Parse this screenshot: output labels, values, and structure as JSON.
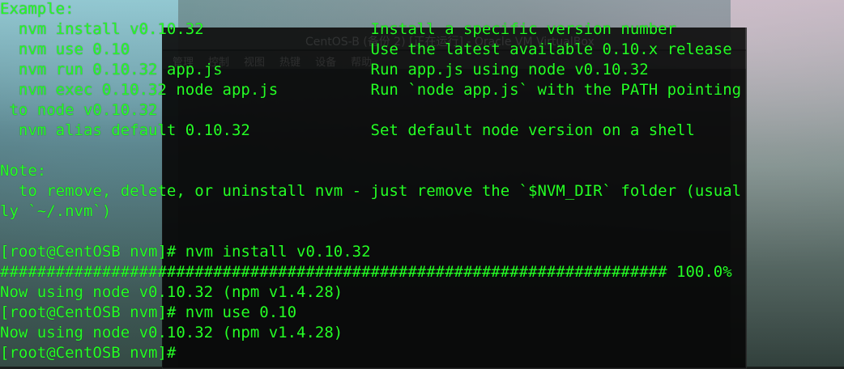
{
  "vbox": {
    "title": "CentOS-B (备份 2) [正在运行] - Oracle VM VirtualBox",
    "menu": [
      "管理",
      "控制",
      "视图",
      "热键",
      "设备",
      "帮助"
    ]
  },
  "terminal": {
    "lines": [
      "Example:",
      "  nvm install v0.10.32                  Install a specific version number",
      "  nvm use 0.10                          Use the latest available 0.10.x release",
      "  nvm run 0.10.32 app.js                Run app.js using node v0.10.32",
      "  nvm exec 0.10.32 node app.js          Run `node app.js` with the PATH pointing",
      " to node v0.10.32",
      "  nvm alias default 0.10.32             Set default node version on a shell",
      "",
      "Note:",
      "  to remove, delete, or uninstall nvm - just remove the `$NVM_DIR` folder (usual",
      "ly `~/.nvm`)",
      "",
      "[root@CentOSB nvm]# nvm install v0.10.32",
      "######################################################################## 100.0%",
      "Now using node v0.10.32 (npm v1.4.28)",
      "[root@CentOSB nvm]# nvm use 0.10",
      "Now using node v0.10.32 (npm v1.4.28)",
      "[root@CentOSB nvm]#"
    ]
  }
}
